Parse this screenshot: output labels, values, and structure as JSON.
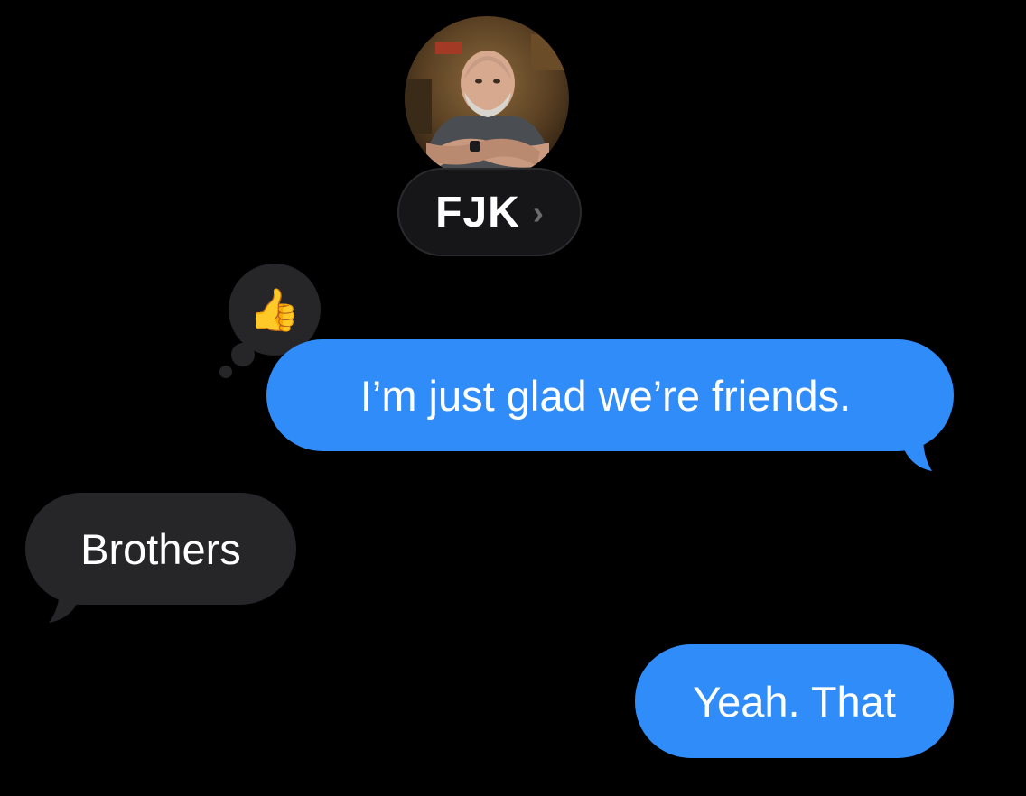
{
  "contact": {
    "name": "FJK",
    "chevron": "›",
    "avatar_icon": "contact-photo"
  },
  "tapback": {
    "emoji": "👍",
    "icon": "thumbs-up-icon"
  },
  "messages": [
    {
      "direction": "outgoing",
      "text": "I’m just glad we’re friends."
    },
    {
      "direction": "incoming",
      "text": "Brothers"
    },
    {
      "direction": "outgoing",
      "text": "Yeah. That"
    }
  ],
  "colors": {
    "background": "#000000",
    "outgoing_bubble": "#2f8cf8",
    "incoming_bubble": "#262629",
    "text": "#ffffff"
  }
}
